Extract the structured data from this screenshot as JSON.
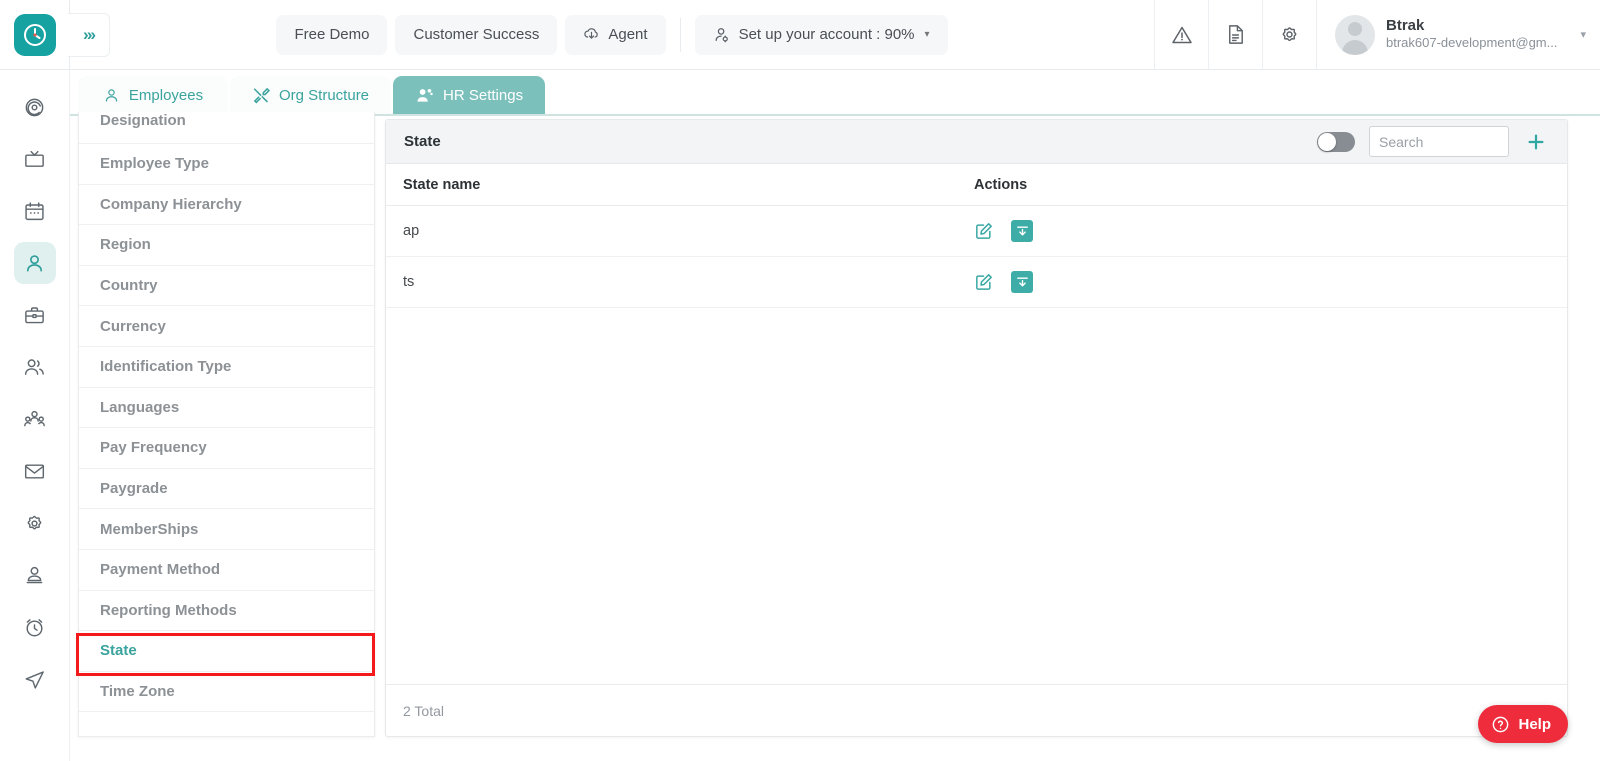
{
  "header": {
    "logo_icon": "clock-logo-icon",
    "expand_icon": "chevrons-right-icon",
    "nav_buttons": [
      {
        "label": "Free Demo",
        "icon": null
      },
      {
        "label": "Customer Success",
        "icon": null
      },
      {
        "label": "Agent",
        "icon": "cloud-download-icon"
      },
      {
        "label": "Set up your account : 90%",
        "icon": "user-gear-icon",
        "caret": "▾"
      }
    ],
    "icons": [
      {
        "name": "warning-triangle-icon"
      },
      {
        "name": "document-icon"
      },
      {
        "name": "gear-icon"
      }
    ],
    "user": {
      "name": "Btrak",
      "email": "btrak607-development@gm...",
      "avatar_icon": "avatar-icon",
      "caret": "▾"
    }
  },
  "tabs": [
    {
      "label": "Employees",
      "icon": "user-icon",
      "active": false
    },
    {
      "label": "Org Structure",
      "icon": "tools-icon",
      "active": false
    },
    {
      "label": "HR Settings",
      "icon": "users-gear-icon",
      "active": true
    }
  ],
  "rail": [
    {
      "name": "dashboard-spiral-icon",
      "active": false
    },
    {
      "name": "tv-icon",
      "active": false
    },
    {
      "name": "calendar-icon",
      "active": false
    },
    {
      "name": "person-icon",
      "active": true
    },
    {
      "name": "briefcase-icon",
      "active": false
    },
    {
      "name": "group-icon",
      "active": false
    },
    {
      "name": "team-icon",
      "active": false
    },
    {
      "name": "mail-icon",
      "active": false
    },
    {
      "name": "settings-gear-icon",
      "active": false
    },
    {
      "name": "user-badge-icon",
      "active": false
    },
    {
      "name": "alarm-clock-icon",
      "active": false
    },
    {
      "name": "send-icon",
      "active": false
    }
  ],
  "menu": {
    "items": [
      {
        "label": "Designation",
        "selected": false
      },
      {
        "label": "Employee Type",
        "selected": false
      },
      {
        "label": "Company Hierarchy",
        "selected": false
      },
      {
        "label": "Region",
        "selected": false
      },
      {
        "label": "Country",
        "selected": false
      },
      {
        "label": "Currency",
        "selected": false
      },
      {
        "label": "Identification Type",
        "selected": false
      },
      {
        "label": "Languages",
        "selected": false
      },
      {
        "label": "Pay Frequency",
        "selected": false
      },
      {
        "label": "Paygrade",
        "selected": false
      },
      {
        "label": "MemberShips",
        "selected": false
      },
      {
        "label": "Payment Method",
        "selected": false
      },
      {
        "label": "Reporting Methods",
        "selected": false
      },
      {
        "label": "State",
        "selected": true
      },
      {
        "label": "Time Zone",
        "selected": false
      }
    ]
  },
  "panel": {
    "title": "State",
    "toggle_on": false,
    "search_placeholder": "Search",
    "search_value": "",
    "add_icon": "plus-icon",
    "columns": [
      "State name",
      "Actions"
    ],
    "rows": [
      {
        "name": "ap",
        "edit_icon": "edit-pencil-icon",
        "archive_icon": "archive-down-icon"
      },
      {
        "name": "ts",
        "edit_icon": "edit-pencil-icon",
        "archive_icon": "archive-down-icon"
      }
    ],
    "total": "2 Total"
  },
  "help": {
    "label": "Help",
    "icon": "question-circle-icon"
  },
  "colors": {
    "brand_teal": "#17a2a2",
    "tab_active": "#7cc0bc",
    "link_teal": "#3aa39d",
    "action_teal": "#3fada7",
    "help_red": "#ee2c3c",
    "highlight_red": "#f41a1a"
  }
}
